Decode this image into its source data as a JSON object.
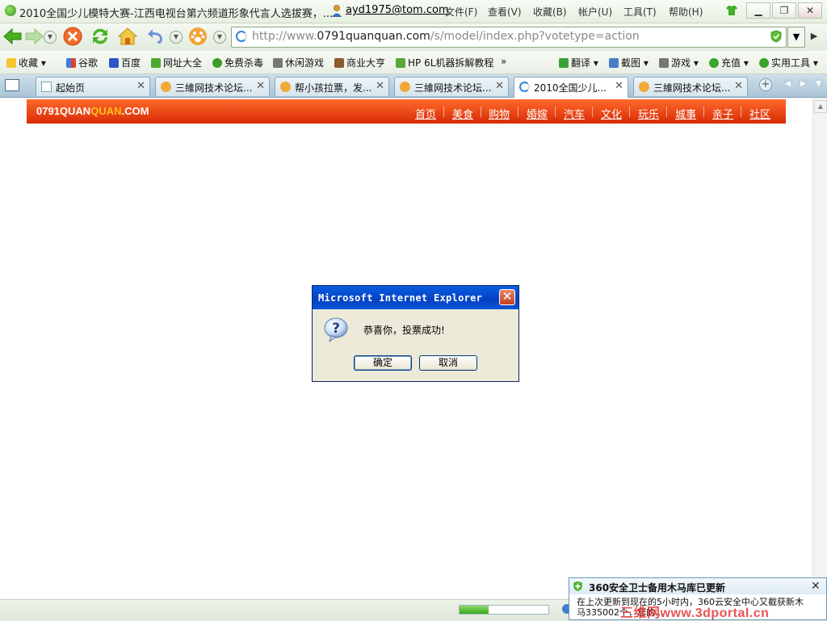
{
  "window": {
    "title": "2010全国少儿模特大赛-江西电视台第六频道形象代言人选拔赛，...",
    "user_email": "ayd1975@tom.com",
    "menu": [
      "文件(F)",
      "查看(V)",
      "收藏(B)",
      "帐户(U)",
      "工具(T)",
      "帮助(H)"
    ]
  },
  "address_bar": {
    "prefix": "http://www.",
    "domain": "0791quanquan.com",
    "path": "/s/model/index.php?votetype=action"
  },
  "bookmarks": [
    "收藏",
    "谷歌",
    "百度",
    "网址大全",
    "免费杀毒",
    "休闲游戏",
    "商业大亨",
    "HP 6L机器拆解教程",
    "»"
  ],
  "bookmark_tools": [
    "翻译",
    "截图",
    "游戏",
    "充值",
    "实用工具"
  ],
  "tabs": [
    {
      "label": "起始页"
    },
    {
      "label": "三維网技术论坛..."
    },
    {
      "label": "帮小孩拉票，发..."
    },
    {
      "label": "三維网技术论坛..."
    },
    {
      "label": "2010全国少儿..."
    },
    {
      "label": "三維网技术论坛..."
    }
  ],
  "site": {
    "logo_main": "0791QUAN",
    "logo_accent": "QUAN",
    "logo_suffix": ".COM",
    "nav": [
      "首页",
      "美食",
      "购物",
      "婚嫁",
      "汽车",
      "文化",
      "玩乐",
      "城事",
      "亲子",
      "社区"
    ]
  },
  "dialog": {
    "title": "Microsoft Internet Explorer",
    "message": "恭喜你，投票成功!",
    "ok_label": "确定",
    "cancel_label": "取消"
  },
  "status": {
    "progress": 0.33
  },
  "popup": {
    "title": "360安全卫士备用木马库已更新",
    "line1": "在上次更新到现在的5小时内，360云安全中心又截获新木",
    "line2": "马335002个，您的..."
  },
  "watermark": "三维网www.3dportal.cn",
  "colors": {
    "site_header": "#e23a0b",
    "logo_accent": "#ffc21a",
    "dialog_title": "#0a4fd4"
  }
}
